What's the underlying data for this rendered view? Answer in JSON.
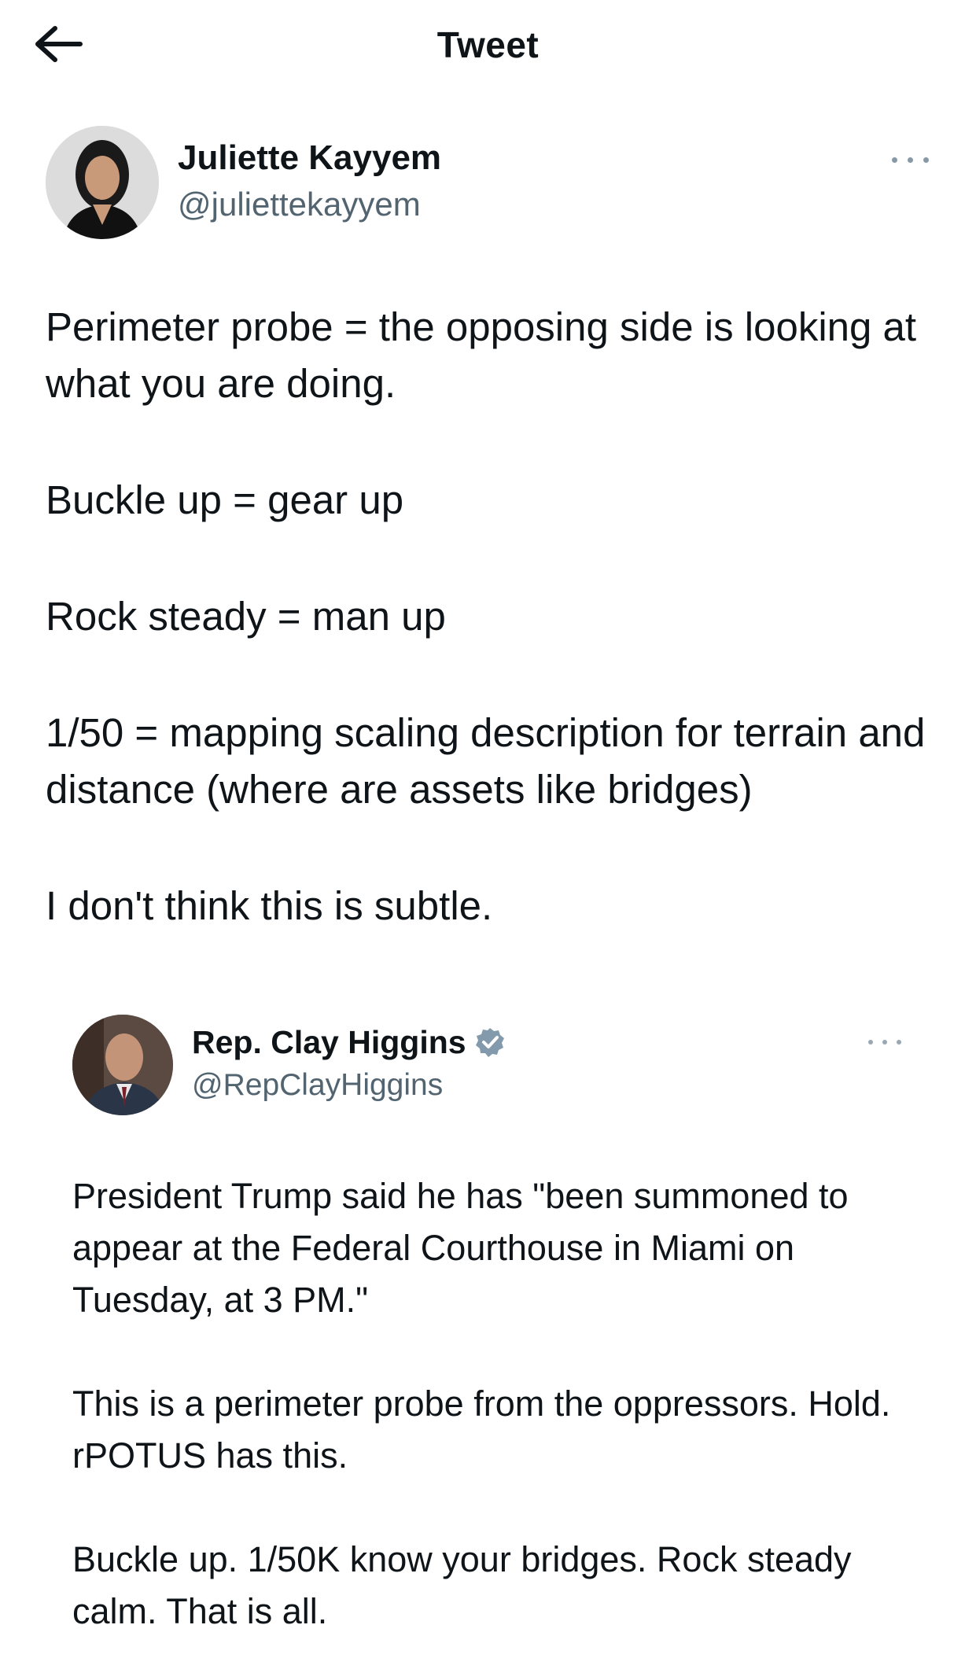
{
  "header": {
    "title": "Tweet",
    "back_icon": "arrow-left-icon"
  },
  "tweet": {
    "author": {
      "name": "Juliette Kayyem",
      "handle": "@juliettekayyem"
    },
    "more_icon": "more-dots-icon",
    "paragraphs": [
      "Perimeter probe = the opposing side is looking at what you are doing.",
      "Buckle up = gear up",
      "Rock steady = man up",
      "1/50 = mapping scaling description for terrain and distance (where are assets like bridges)",
      "I don't think this is subtle."
    ]
  },
  "quoted_tweet": {
    "author": {
      "name": "Rep. Clay Higgins",
      "handle": "@RepClayHiggins",
      "verified_icon": "verified-badge-icon"
    },
    "more_icon": "more-dots-icon",
    "paragraphs": [
      "President Trump said he has \"been summoned to appear at the Federal Courthouse in Miami on Tuesday, at 3 PM.\"",
      "This is a perimeter probe from the oppressors. Hold. rPOTUS has this.",
      "Buckle up. 1/50K know your bridges. Rock steady calm. That is all."
    ]
  },
  "colors": {
    "text": "#0f1419",
    "secondary": "#536471",
    "verified": "#829aab"
  }
}
